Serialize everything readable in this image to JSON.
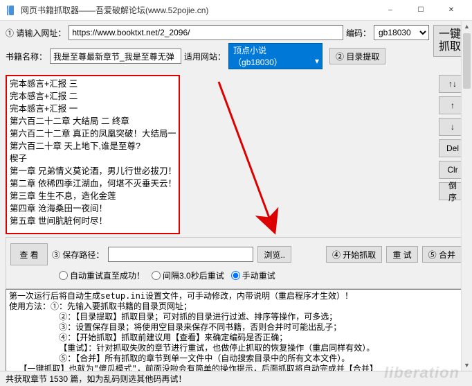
{
  "window": {
    "title": "网页书籍抓取器——吾爱破解论坛(www.52pojie.cn)"
  },
  "labels": {
    "input_url": "① 请输入网址：",
    "encoding": "编码：",
    "bookname": "书籍名称：",
    "apply_site": "适用网站：",
    "extract_toc": "② 目录提取",
    "one_click": "一键\n抓取",
    "view": "查 看",
    "save_path": "③ 保存路径：",
    "browse": "浏览..",
    "start_crawl": "④ 开始抓取",
    "retry": "重 试",
    "merge": "⑤ 合并",
    "radio_auto": "自动重试直至成功！",
    "radio_interval": "间隔3.0秒后重试",
    "radio_manual": "手动重试"
  },
  "values": {
    "url": "https://www.booktxt.net/2_2096/",
    "encoding": "gb18030",
    "bookname": "我是至尊最新章节_我是至尊无弹",
    "site": "顶点小说（gb18030）",
    "save_path": ""
  },
  "side_buttons": {
    "swap": "↑↓",
    "up": "↑",
    "down": "↓",
    "del": "Del",
    "clr": "Clr",
    "reverse": "倒序"
  },
  "chapters": [
    "完本感言+汇报  三",
    "完本感言+汇报  二",
    "完本感言+汇报  一",
    "第六百二十二章 大结局  二  终章",
    "第六百二十二章 真正的凤凰突破！大结局一",
    "第六百二十章 天上地下,谁是至尊?",
    "楔子",
    "第一章 兄弟情义莫论酒，男儿行世必拔刀！",
    "第二章 依稀四季江湖血，何堪不灭垂天云！",
    "第三章 生生不息，造化金莲",
    "第四章 沧海桑田一夜间！",
    "第五章 世间肮脏何时尽！"
  ],
  "log_text": "第一次运行后将自动生成setup.ini设置文件，可手动修改，内带说明（重启程序才生效）！\n使用方法：①：先输入要抓取书籍的目录页网址；\n          ②：【目录提取】抓取目录；可对抓的目录进行过滤、排序等操作，可多选；\n          ③：设置保存目录；将使用空目录来保存不同书籍，否则合并时可能出乱子；\n          ④：【开始抓取】抓取前建议用【查看】来确定编码是否正确；\n          【重试】：针对抓取失败的章节进行重试，也做停止抓取的恢复操作（重启同样有效）。\n          ⑤：【合并】所有抓取的章节到单一文件中（自动搜索目录中的所有文本文件）。\n  【一键抓取】也就为\"傻瓜模式\"，前面没啦会有简单的操作提示，后面抓取将自动完成并【合并】\n  出现多次抓取失败时，可能为网络原因，建议稍后再试（换到别处重试，再完成一次抓取后过段时\n再试。也可关闭程序，再运行时指定原保存的目录可重试）。全部章节抓取成功后，用【合并】将所",
  "status": "共获取章节 1530 篇，如为乱码则选其他码再试！"
}
